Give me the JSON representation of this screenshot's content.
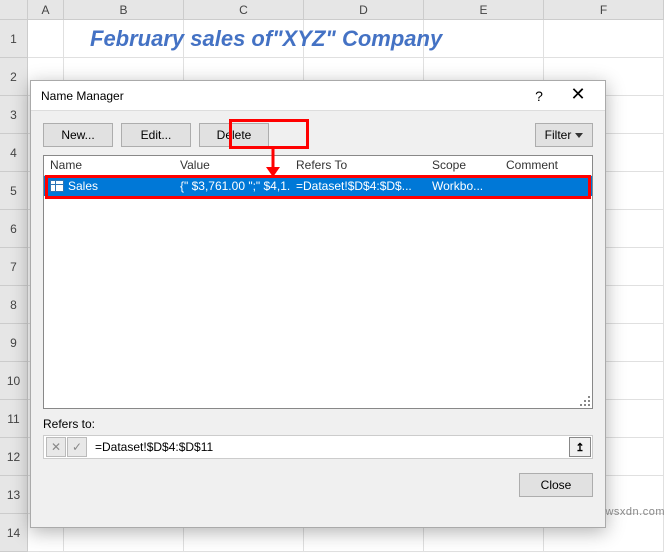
{
  "sheet": {
    "columns": [
      "A",
      "B",
      "C",
      "D",
      "E",
      "F"
    ],
    "rows": [
      "1",
      "2",
      "3",
      "4",
      "5",
      "6",
      "7",
      "8",
      "9",
      "10",
      "11",
      "12",
      "13",
      "14"
    ],
    "title_cell": "February sales of\"XYZ\" Company"
  },
  "dialog": {
    "title": "Name Manager",
    "buttons": {
      "new": "New...",
      "edit": "Edit...",
      "delete": "Delete",
      "filter": "Filter",
      "close": "Close"
    },
    "headers": {
      "name": "Name",
      "value": "Value",
      "refers": "Refers To",
      "scope": "Scope",
      "comment": "Comment"
    },
    "row": {
      "name": "Sales",
      "value": "{\" $3,761.00 \";\" $4,1...",
      "refers": "=Dataset!$D$4:$D$...",
      "scope": "Workbo...",
      "comment": ""
    },
    "refers_label": "Refers to:",
    "refers_value": "=Dataset!$D$4:$D$11",
    "cancel_glyph": "✕",
    "confirm_glyph": "✓",
    "collapse_glyph": "↥",
    "help_glyph": "?",
    "close_glyph": "✕"
  },
  "watermark": "wsxdn.com"
}
